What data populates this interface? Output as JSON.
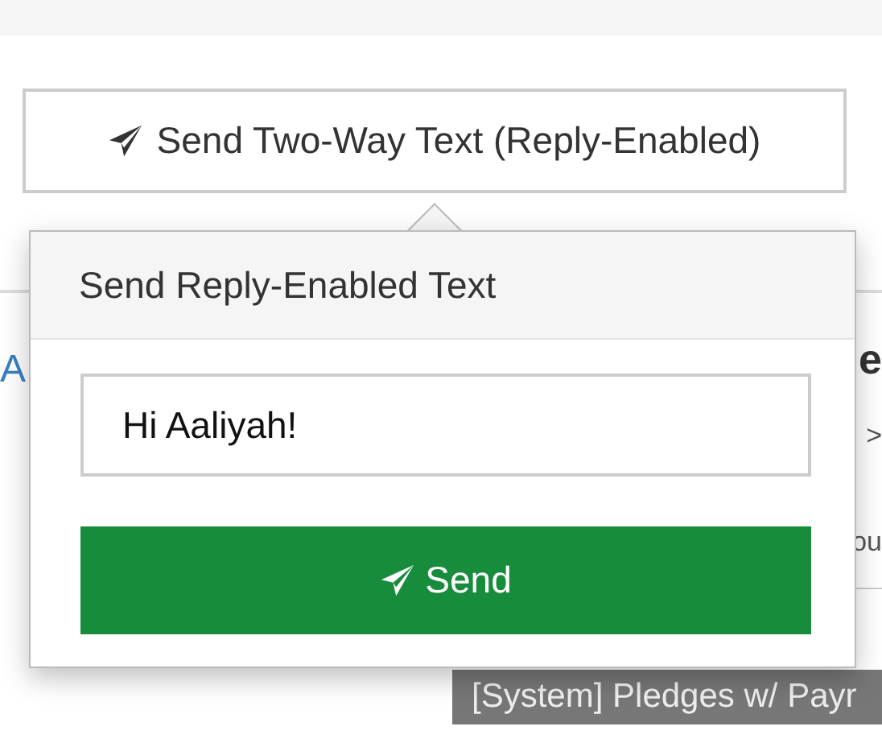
{
  "trigger_button": {
    "label": "Send Two-Way Text (Reply-Enabled)"
  },
  "background": {
    "link_fragment": "A",
    "heading_fragment": "e",
    "chevron_fragment": ">",
    "text_fragment": "ou",
    "report_tag": "[System] Pledges w/ Payr"
  },
  "popover": {
    "title": "Send Reply-Enabled Text",
    "message": {
      "value": "Hi Aaliyah!"
    },
    "send_button": {
      "label": "Send"
    }
  }
}
